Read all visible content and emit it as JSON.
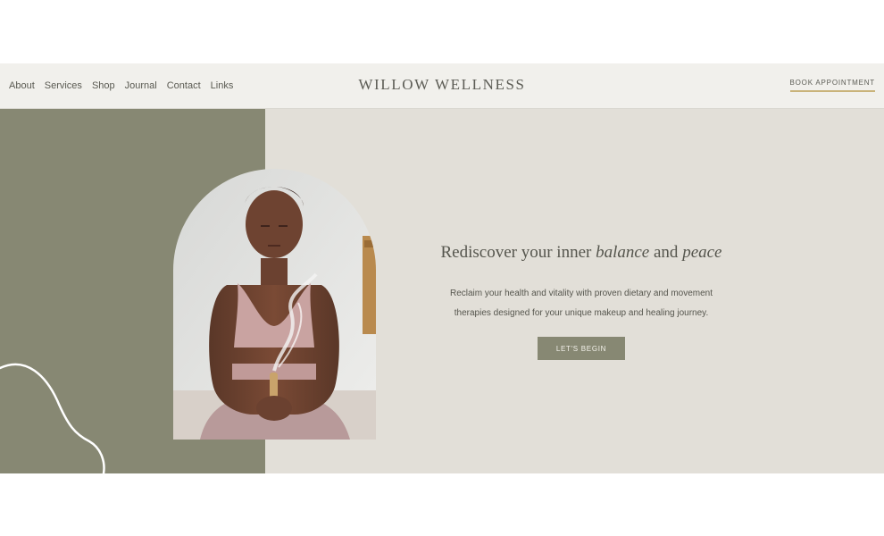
{
  "nav": {
    "items": [
      {
        "label": "About"
      },
      {
        "label": "Services"
      },
      {
        "label": "Shop"
      },
      {
        "label": "Journal"
      },
      {
        "label": "Contact"
      },
      {
        "label": "Links"
      }
    ]
  },
  "brand": {
    "logo": "WILLOW WELLNESS"
  },
  "header": {
    "book_label": "BOOK APPOINTMENT"
  },
  "hero": {
    "headline": {
      "part1": "Rediscover your inner ",
      "em1": "balance",
      "part2": " and ",
      "em2": "peace"
    },
    "subtext_line1": "Reclaim your health and vitality with proven dietary and movement",
    "subtext_line2": "therapies designed for your unique makeup and healing journey.",
    "cta_label": "LET'S BEGIN"
  },
  "colors": {
    "sage": "#878873",
    "sand": "#e2dfd8",
    "header_bg": "#f1f0ec",
    "gold_accent": "#c9b37a",
    "text": "#55554d"
  }
}
